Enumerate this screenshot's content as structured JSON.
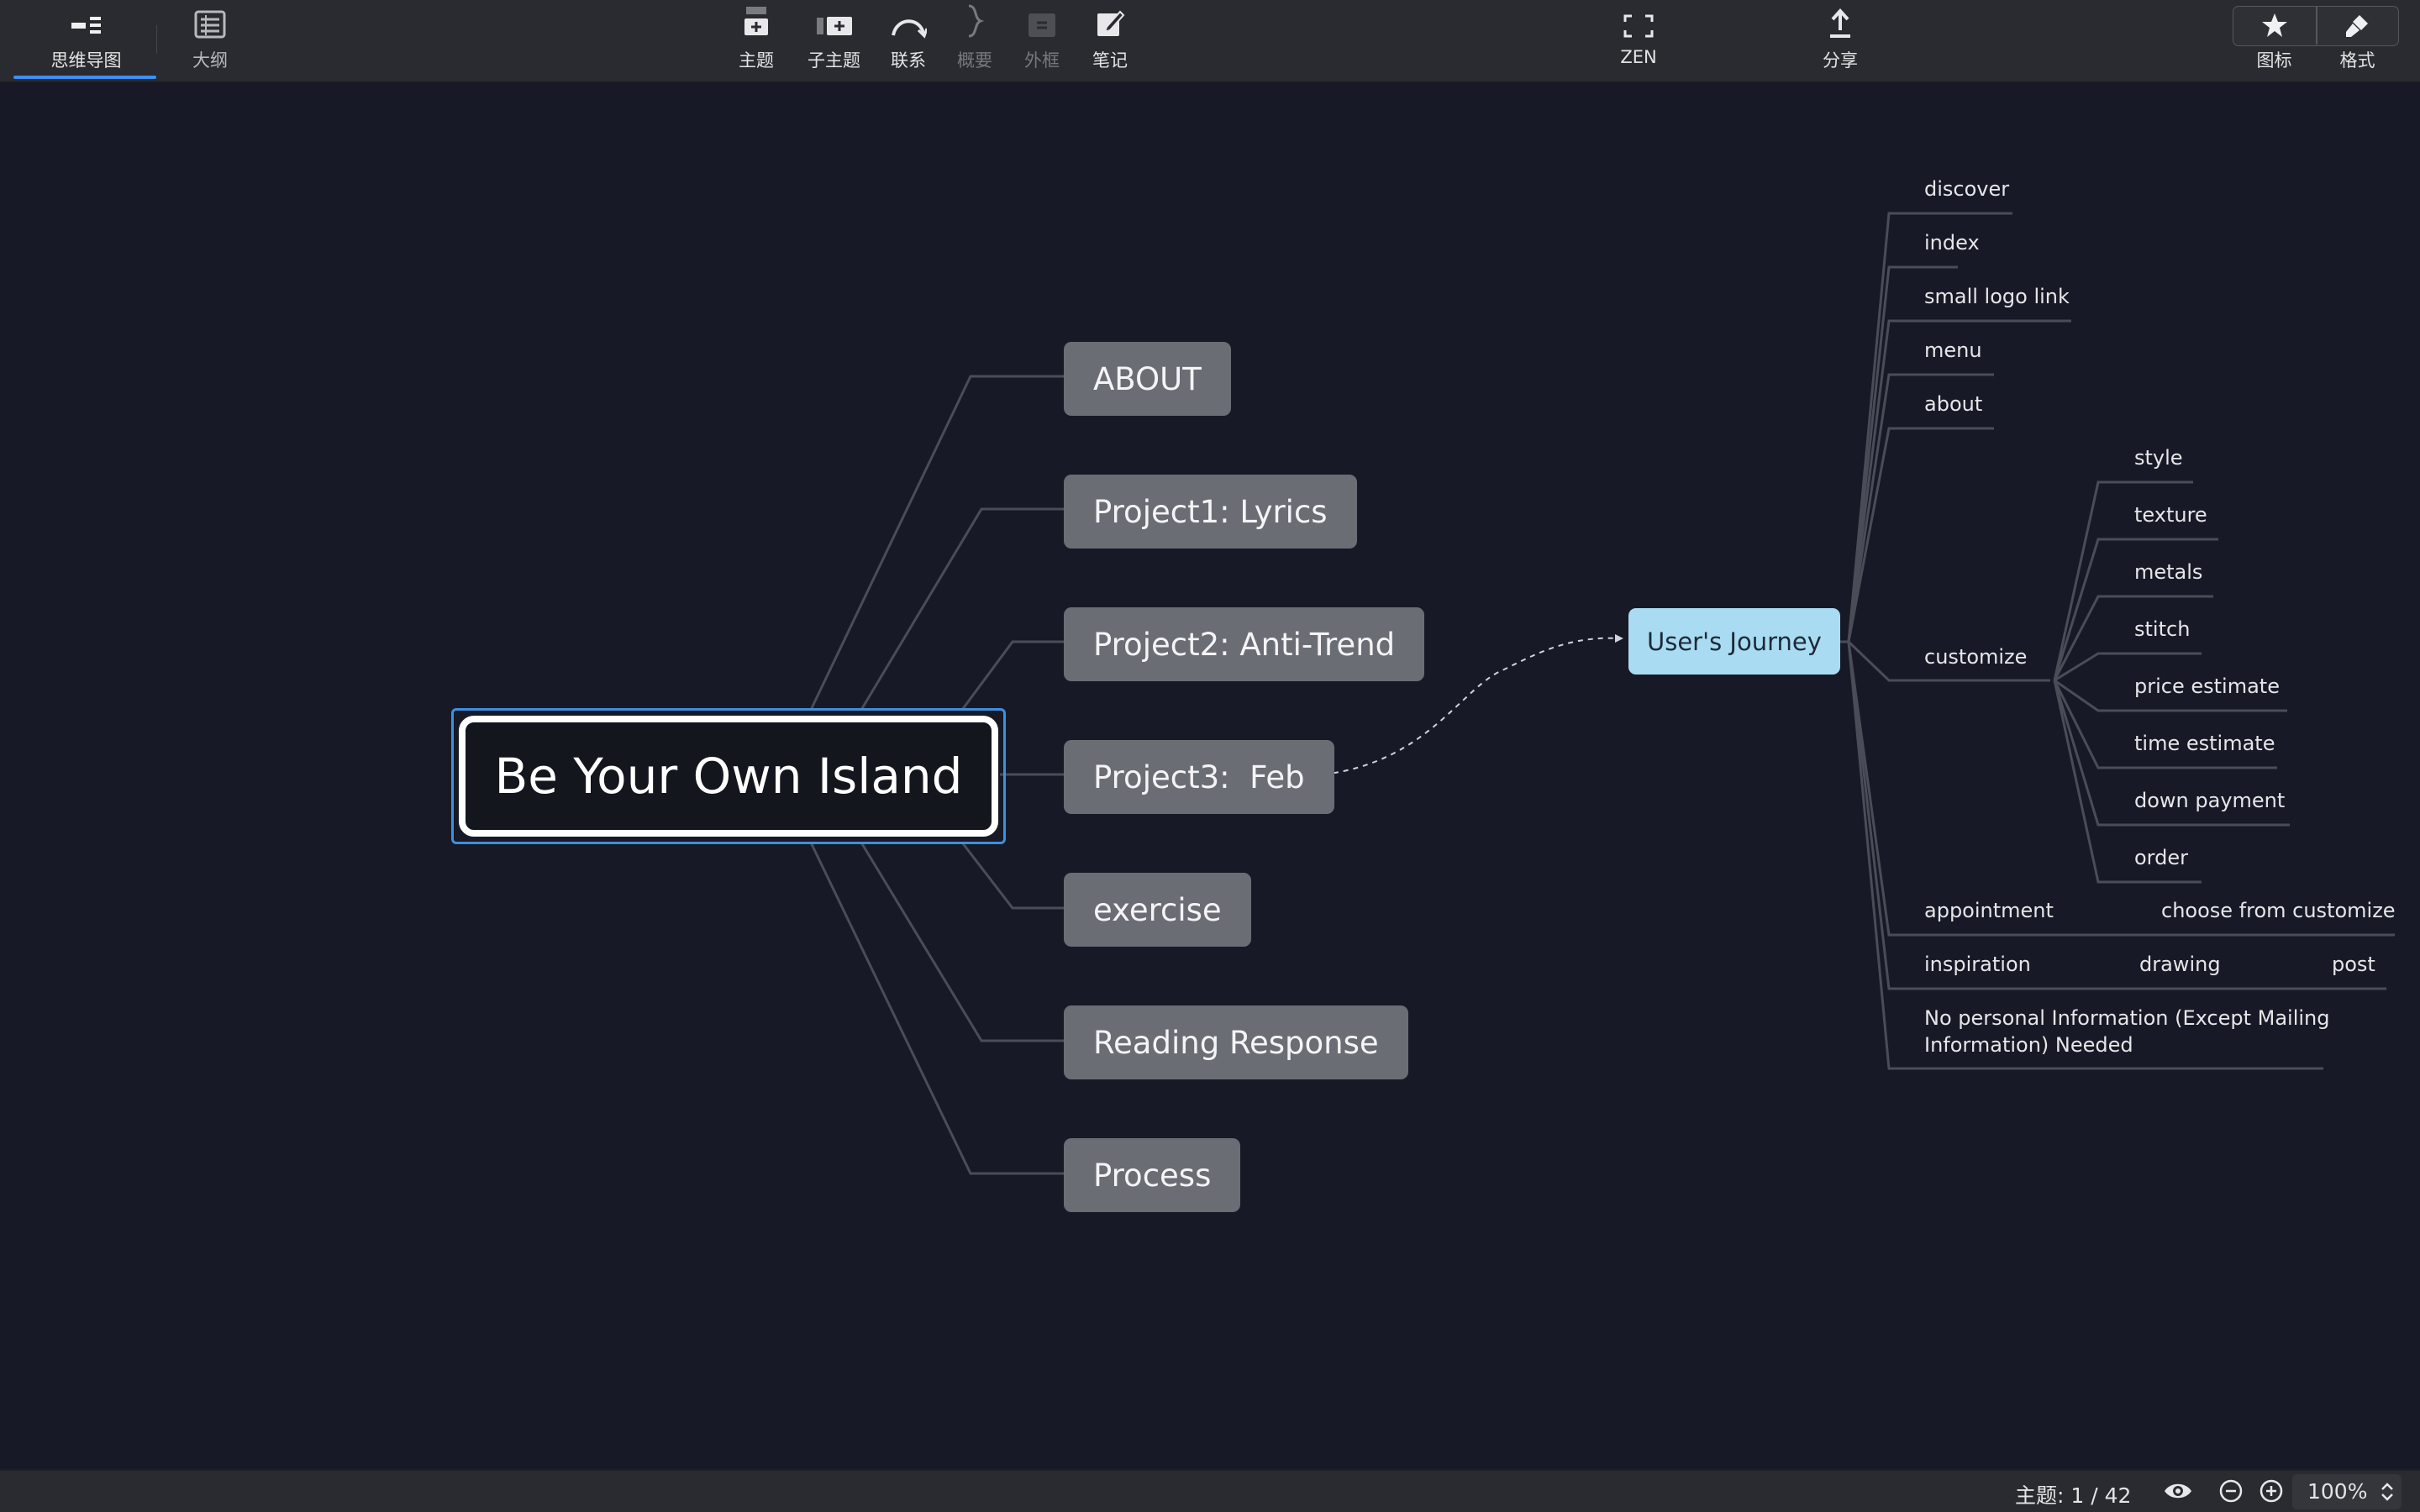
{
  "toolbar": {
    "tabs": [
      {
        "label": "思维导图",
        "active": true
      },
      {
        "label": "大纲",
        "active": false
      }
    ],
    "insert": [
      {
        "label": "主题",
        "icon": "topic-icon",
        "enabled": true
      },
      {
        "label": "子主题",
        "icon": "subtopic-icon",
        "enabled": true
      },
      {
        "label": "联系",
        "icon": "relationship-icon",
        "enabled": true
      },
      {
        "label": "概要",
        "icon": "summary-icon",
        "enabled": false
      },
      {
        "label": "外框",
        "icon": "boundary-icon",
        "enabled": false
      },
      {
        "label": "笔记",
        "icon": "note-icon",
        "enabled": true
      }
    ],
    "zen": {
      "label": "ZEN",
      "icon": "fullscreen-icon"
    },
    "share": {
      "label": "分享",
      "icon": "share-icon"
    },
    "panels": [
      {
        "label": "图标",
        "icon": "star-icon"
      },
      {
        "label": "格式",
        "icon": "format-brush-icon"
      }
    ]
  },
  "mindmap": {
    "root": "Be Your Own Island",
    "branches": [
      "ABOUT",
      "Project1: Lyrics",
      "Project2: Anti-Trend",
      "Project3:  Feb",
      "exercise",
      "Reading Response",
      "Process"
    ],
    "floating_topic": "User's Journey",
    "journey_children": [
      "discover",
      "index",
      "small logo link",
      "menu",
      "about",
      "customize",
      "appointment",
      "inspiration",
      "No personal Information (Except Mailing",
      "Information) Needed"
    ],
    "customize_children": [
      "style",
      "texture",
      "metals",
      "stitch",
      "price estimate",
      "time estimate",
      "down payment",
      "order"
    ],
    "appointment_children": [
      "choose from customize"
    ],
    "inspiration_children": [
      "drawing",
      "post"
    ]
  },
  "statusbar": {
    "topic_count": "主题: 1 / 42",
    "zoom": "100%"
  },
  "colors": {
    "canvas_bg": "#171a26",
    "branch_fill": "#6b6d75",
    "floating_fill": "#a9dcf2",
    "selection": "#3d8fe0",
    "connector": "#4a4d57"
  }
}
